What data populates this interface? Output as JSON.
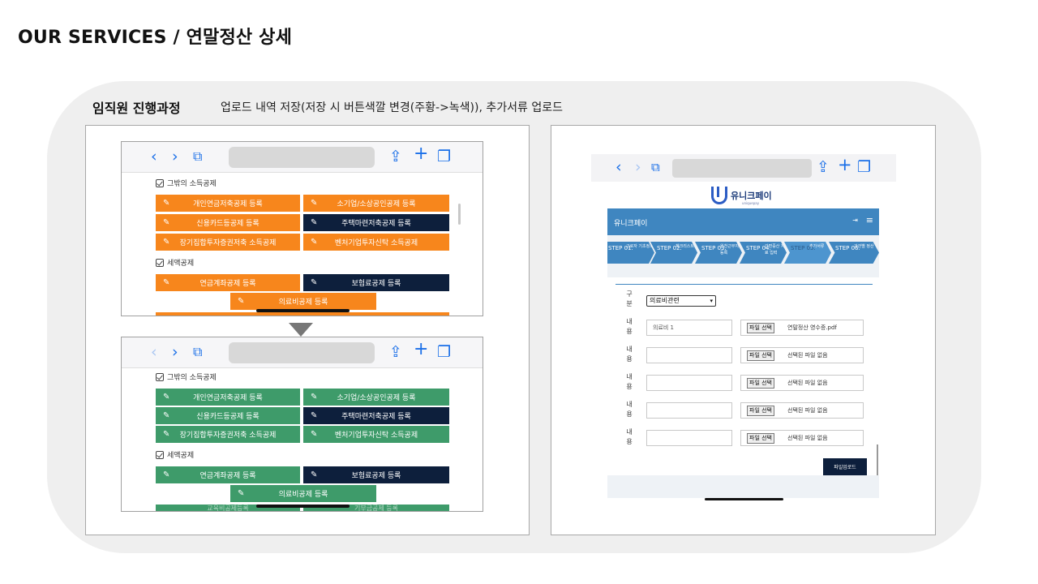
{
  "page": {
    "title": "OUR SERVICES / 연말정산 상세",
    "section_label": "임직원 진행과정",
    "section_desc": "업로드 내역 저장(저장 시 버튼색깔 변경(주황->녹색)), 추가서류 업로드"
  },
  "icons": {
    "back": "‹",
    "forward": "›",
    "book": "⧉",
    "share": "⇪",
    "add": "+",
    "tabs": "❐",
    "pen": "✎"
  },
  "colors": {
    "orange": "#f7861c",
    "green": "#3e9b6a",
    "navy": "#0d1f3c",
    "app_blue": "#3f86c0"
  },
  "left_top": {
    "group1_title": "그밖의 소득공제",
    "buttons": [
      "개인연금저축공제 등록",
      "소기업/소상공인공제 등록",
      "신용카드등공제 등록",
      "주택마련저축공제 등록",
      "장기집합투자증권저축 소득공제",
      "벤처기업투자신탁 소득공제"
    ],
    "group2_title": "세액공제",
    "buttons2": [
      "연금계좌공제 등록",
      "보험료공제 등록",
      "의료비공제 등록"
    ]
  },
  "left_bottom": {
    "group1_title": "그밖의 소득공제",
    "buttons": [
      "개인연금저축공제 등록",
      "소기업/소상공인공제 등록",
      "신용카드등공제 등록",
      "주택마련저축공제 등록",
      "장기집합투자증권저축 소득공제",
      "벤처기업투자신탁 소득공제"
    ],
    "group2_title": "세액공제",
    "buttons2": [
      "연금계좌공제 등록",
      "보험료공제 등록",
      "의료비공제 등록"
    ],
    "partial_row": [
      "교육비공제등록",
      "기부금공제 등록"
    ]
  },
  "right": {
    "logo_text": "유니크페이",
    "logo_sub": "uniquepay",
    "header_title": "유니크페이",
    "steps": [
      {
        "num": "STEP 01.",
        "name": "근로자 기초정보"
      },
      {
        "num": "STEP 02.",
        "name": "체크리스트"
      },
      {
        "num": "STEP 03.",
        "name": "원천근무지 등록"
      },
      {
        "num": "STEP 04.",
        "name": "간편증산 자료 입력"
      },
      {
        "num": "STEP 05.",
        "name": "추가서류"
      },
      {
        "num": "STEP 06.",
        "name": "가관별 정산"
      }
    ],
    "category_label": "구분",
    "category_value": "의료비관련",
    "content_label": "내용",
    "rows": [
      {
        "text": "의료비 1",
        "file": "연말정산 영수증.pdf"
      },
      {
        "text": "",
        "file": "선택된 파일 없음"
      },
      {
        "text": "",
        "file": "선택된 파일 없음"
      },
      {
        "text": "",
        "file": "선택된 파일 없음"
      },
      {
        "text": "",
        "file": "선택된 파일 없음"
      }
    ],
    "file_pick_label": "파일 선택",
    "upload_button": "파일업로드"
  }
}
